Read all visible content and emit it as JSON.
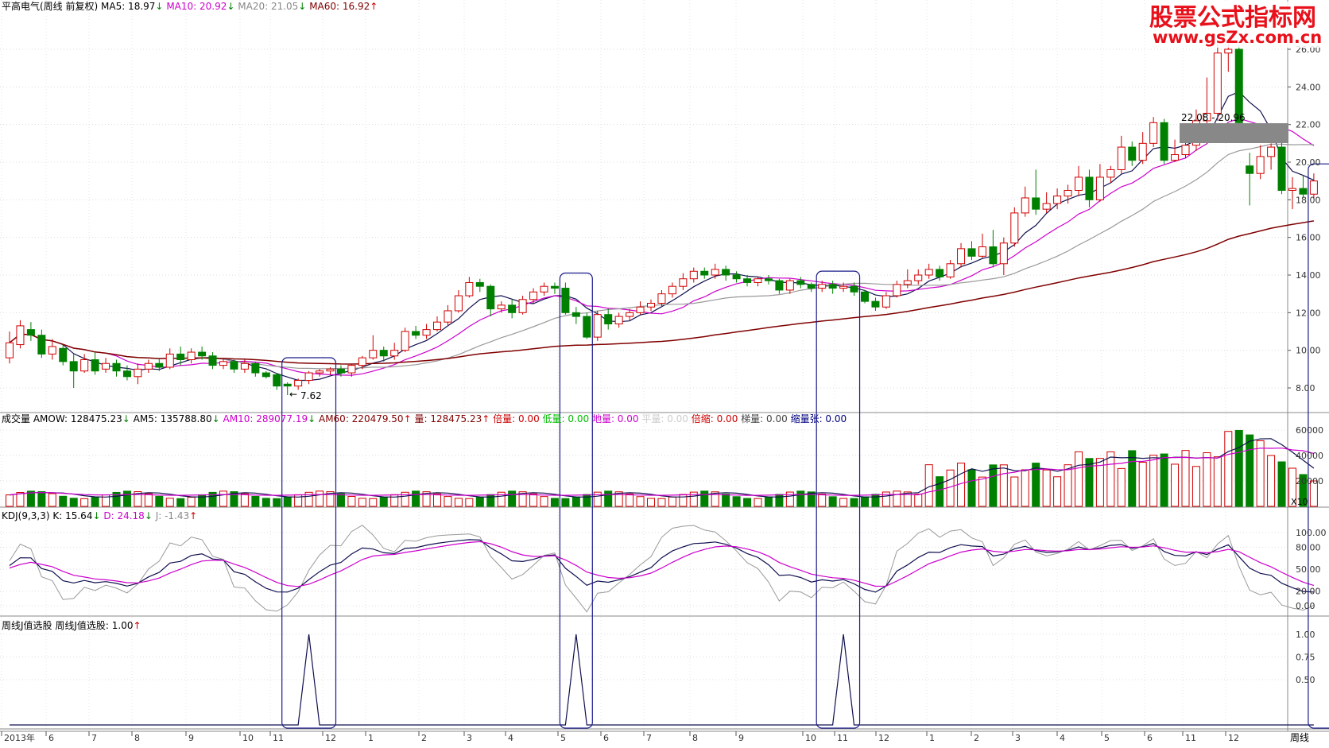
{
  "watermark": {
    "line1": "股票公式指标网",
    "line2": "www.gsZx.com.cn"
  },
  "panels": {
    "price": {
      "title": "平高电气(周线 前复权)",
      "items": [
        {
          "label": "MA5: 18.97",
          "arrow": "↓",
          "color": "#000000"
        },
        {
          "label": "MA10: 20.92",
          "arrow": "↓",
          "color": "#cc00cc"
        },
        {
          "label": "MA20: 21.05",
          "arrow": "↓",
          "color": "#888888"
        },
        {
          "label": "MA60: 16.92",
          "arrow": "↑",
          "color": "#800000"
        }
      ],
      "range_label": "22.08 - 20.96",
      "low_label": "7.62"
    },
    "volume": {
      "items": [
        {
          "label": "成交量",
          "color": "#000000"
        },
        {
          "label": "AMOW: 128475.23",
          "arrow": "↓",
          "color": "#000000"
        },
        {
          "label": "AM5: 135788.80",
          "arrow": "↓",
          "color": "#000000"
        },
        {
          "label": "AM10: 289077.19",
          "arrow": "↓",
          "color": "#cc00cc"
        },
        {
          "label": "AM60: 220479.50",
          "arrow": "↑",
          "color": "#800000"
        },
        {
          "label": "量: 128475.23",
          "arrow": "↑",
          "color": "#800000"
        },
        {
          "label": "倍量: 0.00",
          "color": "#cc0000"
        },
        {
          "label": "低量: 0.00",
          "color": "#00bb00"
        },
        {
          "label": "地量: 0.00",
          "color": "#cc00cc"
        },
        {
          "label": "平量: 0.00",
          "color": "#cccccc"
        },
        {
          "label": "倍缩: 0.00",
          "color": "#cc0000"
        },
        {
          "label": "梯量: 0.00",
          "color": "#444444"
        },
        {
          "label": "缩量张: 0.00",
          "color": "#000080"
        }
      ],
      "x10": "X10"
    },
    "kdj": {
      "items": [
        {
          "label": "KDJ(9,3,3)",
          "color": "#000000"
        },
        {
          "label": "K: 15.64",
          "arrow": "↓",
          "color": "#000000"
        },
        {
          "label": "D: 24.18",
          "arrow": "↓",
          "color": "#cc00cc"
        },
        {
          "label": "J: -1.43",
          "arrow": "↑",
          "color": "#888888"
        }
      ]
    },
    "jpick": {
      "items": [
        {
          "label": "周线J值选股",
          "color": "#000000"
        },
        {
          "label": "周线J值选股: 1.00",
          "arrow": "↑",
          "color": "#000000"
        }
      ]
    }
  },
  "axes": {
    "price_ticks": [
      "26.00",
      "24.00",
      "22.00",
      "20.00",
      "18.00",
      "16.00",
      "14.00",
      "12.00",
      "10.00",
      "8.00"
    ],
    "vol_ticks": [
      "60000",
      "40000",
      "20000"
    ],
    "kdj_ticks": [
      "100.00",
      "80.00",
      "50.00",
      "20.00",
      "0.00"
    ],
    "j_ticks": [
      "1.00",
      "0.75",
      "0.50"
    ],
    "x_labels": [
      "2013年",
      "6",
      "7",
      "8",
      "9",
      "10",
      "11",
      "12",
      "1",
      "2",
      "3",
      "4",
      "5",
      "6",
      "7",
      "8",
      "9",
      "10",
      "11",
      "12",
      "1",
      "2",
      "3",
      "4",
      "5",
      "6",
      "11",
      "12"
    ],
    "period_label": "周线"
  },
  "chart_data": {
    "type": "candlestick",
    "period": "weekly",
    "price_ylim": [
      7,
      26.5
    ],
    "candles": [
      {
        "o": 9.6,
        "c": 10.4,
        "h": 11.0,
        "l": 9.3
      },
      {
        "o": 10.3,
        "c": 11.3,
        "h": 11.6,
        "l": 10.1
      },
      {
        "o": 11.1,
        "c": 10.8,
        "h": 11.5,
        "l": 10.5
      },
      {
        "o": 10.8,
        "c": 9.8,
        "h": 11.1,
        "l": 9.6
      },
      {
        "o": 9.8,
        "c": 10.2,
        "h": 10.6,
        "l": 9.5
      },
      {
        "o": 10.1,
        "c": 9.4,
        "h": 10.3,
        "l": 9.2
      },
      {
        "o": 9.4,
        "c": 8.9,
        "h": 9.8,
        "l": 8.0
      },
      {
        "o": 8.9,
        "c": 9.5,
        "h": 9.8,
        "l": 8.8
      },
      {
        "o": 9.5,
        "c": 8.9,
        "h": 9.9,
        "l": 8.7
      },
      {
        "o": 9.0,
        "c": 9.3,
        "h": 9.6,
        "l": 8.8
      },
      {
        "o": 9.3,
        "c": 8.9,
        "h": 9.5,
        "l": 8.6
      },
      {
        "o": 8.9,
        "c": 8.6,
        "h": 9.2,
        "l": 8.4
      },
      {
        "o": 8.6,
        "c": 9.0,
        "h": 9.3,
        "l": 8.2
      },
      {
        "o": 9.0,
        "c": 9.3,
        "h": 9.5,
        "l": 8.8
      },
      {
        "o": 9.3,
        "c": 9.1,
        "h": 9.6,
        "l": 8.9
      },
      {
        "o": 9.1,
        "c": 9.8,
        "h": 10.1,
        "l": 9.0
      },
      {
        "o": 9.8,
        "c": 9.5,
        "h": 10.2,
        "l": 9.2
      },
      {
        "o": 9.5,
        "c": 9.9,
        "h": 10.1,
        "l": 9.3
      },
      {
        "o": 9.9,
        "c": 9.7,
        "h": 10.2,
        "l": 9.5
      },
      {
        "o": 9.7,
        "c": 9.2,
        "h": 9.9,
        "l": 9.0
      },
      {
        "o": 9.2,
        "c": 9.4,
        "h": 9.6,
        "l": 9.0
      },
      {
        "o": 9.4,
        "c": 9.0,
        "h": 9.5,
        "l": 8.8
      },
      {
        "o": 9.0,
        "c": 9.3,
        "h": 9.5,
        "l": 8.8
      },
      {
        "o": 9.3,
        "c": 8.8,
        "h": 9.4,
        "l": 8.6
      },
      {
        "o": 8.8,
        "c": 8.6,
        "h": 8.9,
        "l": 8.5
      },
      {
        "o": 8.7,
        "c": 8.1,
        "h": 8.8,
        "l": 7.9
      },
      {
        "o": 8.2,
        "c": 8.1,
        "h": 8.3,
        "l": 7.62
      },
      {
        "o": 8.1,
        "c": 8.4,
        "h": 8.5,
        "l": 7.9
      },
      {
        "o": 8.4,
        "c": 8.8,
        "h": 8.9,
        "l": 8.2
      },
      {
        "o": 8.8,
        "c": 8.9,
        "h": 9.0,
        "l": 8.6
      },
      {
        "o": 8.9,
        "c": 9.0,
        "h": 9.1,
        "l": 8.7
      },
      {
        "o": 9.0,
        "c": 8.8,
        "h": 9.2,
        "l": 8.6
      },
      {
        "o": 8.8,
        "c": 9.2,
        "h": 9.3,
        "l": 8.6
      },
      {
        "o": 9.2,
        "c": 9.6,
        "h": 9.7,
        "l": 9.0
      },
      {
        "o": 9.6,
        "c": 10.0,
        "h": 10.8,
        "l": 9.5
      },
      {
        "o": 10.0,
        "c": 9.7,
        "h": 10.2,
        "l": 9.4
      },
      {
        "o": 9.7,
        "c": 10.0,
        "h": 10.4,
        "l": 9.5
      },
      {
        "o": 10.0,
        "c": 11.0,
        "h": 11.2,
        "l": 9.9
      },
      {
        "o": 11.0,
        "c": 10.8,
        "h": 11.3,
        "l": 10.6
      },
      {
        "o": 10.8,
        "c": 11.1,
        "h": 11.4,
        "l": 10.6
      },
      {
        "o": 11.1,
        "c": 11.5,
        "h": 11.8,
        "l": 11.0
      },
      {
        "o": 11.5,
        "c": 12.1,
        "h": 12.4,
        "l": 11.3
      },
      {
        "o": 12.1,
        "c": 12.9,
        "h": 13.2,
        "l": 12.0
      },
      {
        "o": 12.9,
        "c": 13.6,
        "h": 13.9,
        "l": 12.8
      },
      {
        "o": 13.6,
        "c": 13.4,
        "h": 13.8,
        "l": 13.1
      },
      {
        "o": 13.4,
        "c": 12.2,
        "h": 13.5,
        "l": 11.8
      },
      {
        "o": 12.2,
        "c": 12.4,
        "h": 12.6,
        "l": 12.0
      },
      {
        "o": 12.4,
        "c": 12.0,
        "h": 12.7,
        "l": 11.7
      },
      {
        "o": 12.0,
        "c": 12.7,
        "h": 12.9,
        "l": 11.9
      },
      {
        "o": 12.7,
        "c": 13.1,
        "h": 13.3,
        "l": 12.5
      },
      {
        "o": 13.1,
        "c": 13.4,
        "h": 13.6,
        "l": 12.9
      },
      {
        "o": 13.4,
        "c": 13.3,
        "h": 13.6,
        "l": 13.0
      },
      {
        "o": 13.3,
        "c": 12.0,
        "h": 13.6,
        "l": 11.9
      },
      {
        "o": 12.0,
        "c": 11.8,
        "h": 12.3,
        "l": 11.4
      },
      {
        "o": 11.8,
        "c": 10.7,
        "h": 12.0,
        "l": 10.6
      },
      {
        "o": 10.7,
        "c": 11.9,
        "h": 12.1,
        "l": 10.5
      },
      {
        "o": 11.9,
        "c": 11.4,
        "h": 12.2,
        "l": 11.1
      },
      {
        "o": 11.4,
        "c": 11.8,
        "h": 12.0,
        "l": 11.2
      },
      {
        "o": 11.8,
        "c": 12.0,
        "h": 12.2,
        "l": 11.6
      },
      {
        "o": 12.0,
        "c": 12.3,
        "h": 12.6,
        "l": 11.9
      },
      {
        "o": 12.3,
        "c": 12.5,
        "h": 12.7,
        "l": 12.1
      },
      {
        "o": 12.5,
        "c": 13.0,
        "h": 13.2,
        "l": 12.3
      },
      {
        "o": 13.0,
        "c": 13.4,
        "h": 13.6,
        "l": 12.8
      },
      {
        "o": 13.4,
        "c": 13.8,
        "h": 14.1,
        "l": 13.2
      },
      {
        "o": 13.8,
        "c": 14.2,
        "h": 14.4,
        "l": 13.6
      },
      {
        "o": 14.2,
        "c": 14.0,
        "h": 14.4,
        "l": 13.8
      },
      {
        "o": 14.0,
        "c": 14.3,
        "h": 14.6,
        "l": 13.8
      },
      {
        "o": 14.3,
        "c": 14.0,
        "h": 14.5,
        "l": 13.7
      },
      {
        "o": 14.0,
        "c": 13.8,
        "h": 14.2,
        "l": 13.6
      },
      {
        "o": 13.8,
        "c": 13.6,
        "h": 14.0,
        "l": 13.4
      },
      {
        "o": 13.6,
        "c": 13.8,
        "h": 13.9,
        "l": 13.4
      },
      {
        "o": 13.8,
        "c": 13.7,
        "h": 14.0,
        "l": 13.5
      },
      {
        "o": 13.7,
        "c": 13.2,
        "h": 13.8,
        "l": 13.0
      },
      {
        "o": 13.2,
        "c": 13.7,
        "h": 13.8,
        "l": 13.0
      },
      {
        "o": 13.7,
        "c": 13.5,
        "h": 13.9,
        "l": 13.3
      },
      {
        "o": 13.5,
        "c": 13.3,
        "h": 13.6,
        "l": 13.1
      },
      {
        "o": 13.3,
        "c": 13.5,
        "h": 13.7,
        "l": 13.1
      },
      {
        "o": 13.5,
        "c": 13.3,
        "h": 13.7,
        "l": 13.0
      },
      {
        "o": 13.3,
        "c": 13.4,
        "h": 13.6,
        "l": 13.1
      },
      {
        "o": 13.4,
        "c": 13.1,
        "h": 13.6,
        "l": 12.9
      },
      {
        "o": 13.1,
        "c": 12.6,
        "h": 13.2,
        "l": 12.5
      },
      {
        "o": 12.6,
        "c": 12.3,
        "h": 12.8,
        "l": 12.1
      },
      {
        "o": 12.3,
        "c": 12.9,
        "h": 13.1,
        "l": 12.2
      },
      {
        "o": 12.9,
        "c": 13.5,
        "h": 13.7,
        "l": 12.8
      },
      {
        "o": 13.5,
        "c": 13.7,
        "h": 14.3,
        "l": 13.3
      },
      {
        "o": 13.7,
        "c": 14.0,
        "h": 14.3,
        "l": 13.5
      },
      {
        "o": 14.0,
        "c": 14.3,
        "h": 14.6,
        "l": 13.8
      },
      {
        "o": 14.3,
        "c": 13.9,
        "h": 14.5,
        "l": 13.7
      },
      {
        "o": 13.9,
        "c": 14.6,
        "h": 14.8,
        "l": 13.8
      },
      {
        "o": 14.6,
        "c": 15.4,
        "h": 15.7,
        "l": 14.4
      },
      {
        "o": 15.4,
        "c": 15.0,
        "h": 15.8,
        "l": 14.8
      },
      {
        "o": 15.0,
        "c": 15.5,
        "h": 16.2,
        "l": 14.9
      },
      {
        "o": 15.5,
        "c": 14.6,
        "h": 16.4,
        "l": 14.4
      },
      {
        "o": 14.6,
        "c": 15.7,
        "h": 16.0,
        "l": 14.0
      },
      {
        "o": 15.7,
        "c": 17.3,
        "h": 17.6,
        "l": 15.5
      },
      {
        "o": 17.3,
        "c": 18.1,
        "h": 18.7,
        "l": 17.1
      },
      {
        "o": 18.1,
        "c": 17.5,
        "h": 19.6,
        "l": 17.2
      },
      {
        "o": 17.5,
        "c": 17.8,
        "h": 18.4,
        "l": 17.3
      },
      {
        "o": 17.8,
        "c": 18.2,
        "h": 18.6,
        "l": 17.5
      },
      {
        "o": 18.2,
        "c": 18.5,
        "h": 18.8,
        "l": 17.8
      },
      {
        "o": 18.5,
        "c": 19.2,
        "h": 19.8,
        "l": 18.2
      },
      {
        "o": 19.2,
        "c": 18.0,
        "h": 19.6,
        "l": 17.6
      },
      {
        "o": 18.0,
        "c": 19.2,
        "h": 19.9,
        "l": 17.9
      },
      {
        "o": 19.2,
        "c": 19.6,
        "h": 19.8,
        "l": 18.9
      },
      {
        "o": 19.6,
        "c": 20.8,
        "h": 21.4,
        "l": 19.4
      },
      {
        "o": 20.8,
        "c": 20.1,
        "h": 21.1,
        "l": 19.8
      },
      {
        "o": 20.1,
        "c": 21.0,
        "h": 21.6,
        "l": 19.9
      },
      {
        "o": 21.0,
        "c": 22.1,
        "h": 22.4,
        "l": 20.8
      },
      {
        "o": 22.1,
        "c": 20.1,
        "h": 22.3,
        "l": 19.9
      },
      {
        "o": 20.1,
        "c": 20.4,
        "h": 21.2,
        "l": 20.0
      },
      {
        "o": 20.4,
        "c": 20.9,
        "h": 21.3,
        "l": 20.2
      },
      {
        "o": 20.9,
        "c": 22.2,
        "h": 22.8,
        "l": 20.6
      },
      {
        "o": 22.2,
        "c": 22.6,
        "h": 24.5,
        "l": 21.6
      },
      {
        "o": 22.6,
        "c": 25.8,
        "h": 26.3,
        "l": 22.2
      },
      {
        "o": 25.8,
        "c": 26.0,
        "h": 26.3,
        "l": 24.8
      },
      {
        "o": 26.0,
        "c": 22.1,
        "h": 26.2,
        "l": 21.8
      },
      {
        "o": 19.8,
        "c": 19.4,
        "h": 20.5,
        "l": 17.7
      },
      {
        "o": 19.4,
        "c": 20.3,
        "h": 20.9,
        "l": 19.1
      },
      {
        "o": 20.3,
        "c": 20.8,
        "h": 21.0,
        "l": 19.6
      },
      {
        "o": 20.8,
        "c": 18.5,
        "h": 21.1,
        "l": 18.3
      },
      {
        "o": 18.5,
        "c": 18.6,
        "h": 19.2,
        "l": 17.5
      },
      {
        "o": 18.6,
        "c": 18.3,
        "h": 19.3,
        "l": 18.1
      },
      {
        "o": 18.3,
        "c": 19.0,
        "h": 19.4,
        "l": 18.1
      }
    ],
    "selected_ranges": [
      [
        26,
        30
      ],
      [
        52,
        54
      ],
      [
        76,
        79
      ],
      [
        122,
        124
      ]
    ]
  }
}
